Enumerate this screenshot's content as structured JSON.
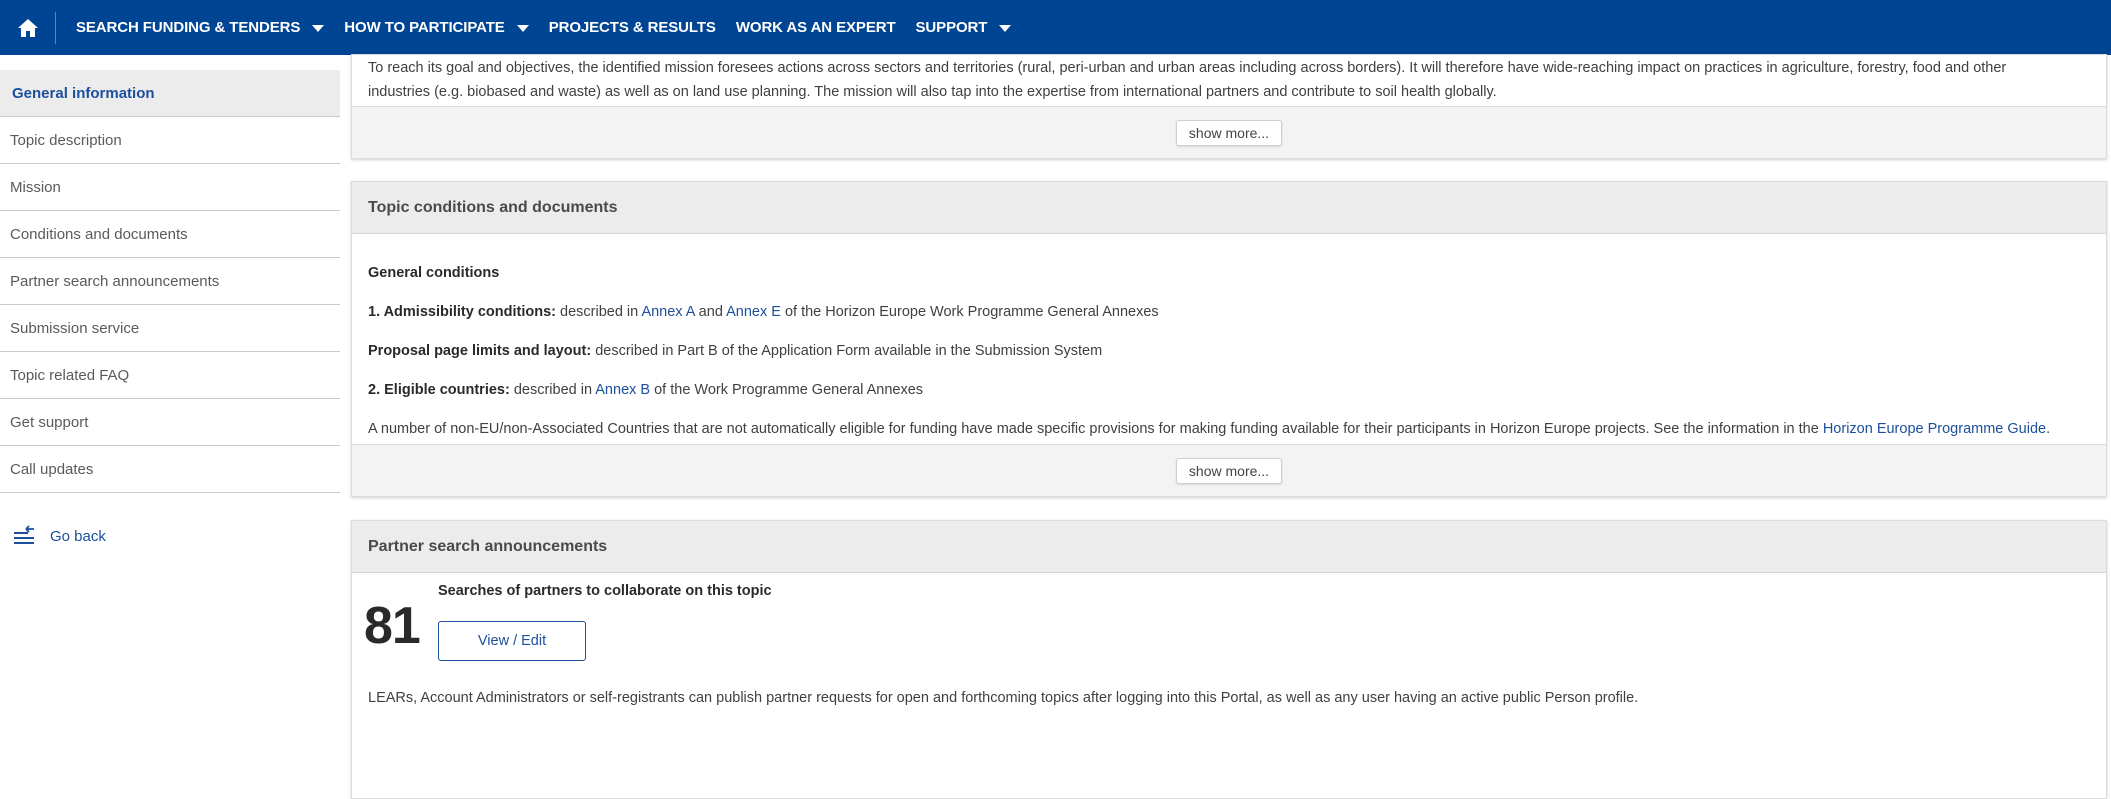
{
  "nav": {
    "items": [
      {
        "label": "SEARCH FUNDING & TENDERS",
        "dropdown": true
      },
      {
        "label": "HOW TO PARTICIPATE",
        "dropdown": true
      },
      {
        "label": "PROJECTS & RESULTS",
        "dropdown": false
      },
      {
        "label": "WORK AS AN EXPERT",
        "dropdown": false
      },
      {
        "label": "SUPPORT",
        "dropdown": true
      }
    ]
  },
  "sidebar": {
    "items": [
      "General information",
      "Topic description",
      "Mission",
      "Conditions and documents",
      "Partner search announcements",
      "Submission service",
      "Topic related FAQ",
      "Get support",
      "Call updates"
    ],
    "go_back": "Go back"
  },
  "mission_panel": {
    "text_1": "To reach its goal and objectives, the identified mission foresees actions across sectors and territories (rural, peri-urban and urban areas including across borders). It will therefore have wide-reaching impact on practices in agriculture, forestry, food and other",
    "text_2": "industries (e.g. biobased and waste) as well as on land use planning. The mission will also tap into the expertise from international partners and contribute to soil health globally.",
    "show_more": "show more..."
  },
  "conditions_panel": {
    "title": "Topic conditions and documents",
    "general_conditions": "General conditions",
    "admissibility_label": "1. Admissibility conditions:",
    "admissibility_pre": " described in ",
    "annex_a": "Annex A",
    "and": " and ",
    "annex_e": "Annex E",
    "admissibility_post": " of the Horizon Europe Work Programme General Annexes",
    "page_limits_label": "Proposal page limits and layout:",
    "page_limits_text": " described in Part B of the Application Form available in the Submission System",
    "eligible_label": "2. Eligible countries:",
    "eligible_pre": " described in ",
    "annex_b": "Annex B",
    "eligible_post": " of the Work Programme General Annexes",
    "non_eu_text": "A number of non-EU/non-Associated Countries that are not automatically eligible for funding have made specific provisions for making funding available for their participants in Horizon Europe projects. See the information in the ",
    "guide_link": "Horizon Europe Programme Guide",
    "guide_end": ".",
    "show_more": "show more..."
  },
  "psa_panel": {
    "title": "Partner search announcements",
    "count": "81",
    "label": "Searches of partners to collaborate on this topic",
    "button": "View / Edit",
    "note": "LEARs, Account Administrators or self-registrants can publish partner requests for open and forthcoming topics after logging into this Portal, as well as any user having an active public Person profile."
  },
  "colors": {
    "nav_bg": "#004494",
    "link": "#1c4f9c",
    "panel_head": "#ececec"
  }
}
